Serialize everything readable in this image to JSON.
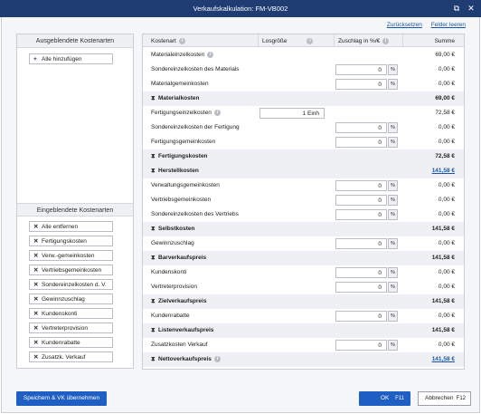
{
  "window": {
    "title": "Verkaufskalkulation: FM-VB002"
  },
  "top_links": {
    "reset": "Zurücksetzen",
    "clear": "Felder leeren"
  },
  "hidden_costs": {
    "title": "Ausgeblendete Kostenarten",
    "add_all": "Alle hinzufügen"
  },
  "shown_costs": {
    "title": "Eingeblendete Kostenarten",
    "items": [
      "Alle entfernen",
      "Fertigungskosten",
      "Verw.-gemeinkosten",
      "Vertriebsgemeinkosten",
      "Sondereinzelkosten d. V.",
      "Gewinnzuschlag",
      "Kundenskonti",
      "Vertreterprovision",
      "Kundenrabatte",
      "Zusatzk. Verkauf"
    ]
  },
  "table": {
    "headers": {
      "kostenart": "Kostenart",
      "losgroesse": "Losgröße",
      "zuschlag": "Zuschlag in %/€",
      "summe": "Summe"
    },
    "rows": [
      {
        "label": "Materialeinzelkosten",
        "sum": "69,00 €",
        "info": true
      },
      {
        "label": "Sondereinzelkosten des Materials",
        "input": "0",
        "unit": "%",
        "sum": "0,00 €"
      },
      {
        "label": "Materialgemeinkosten",
        "input": "0",
        "unit": "%",
        "sum": "0,00 €"
      },
      {
        "label": "Materialkosten",
        "sum": "69,00 €",
        "subtotal": true
      },
      {
        "label": "Fertigungseinzelkosten",
        "lot": "1 Einh",
        "sum": "72,58 €",
        "info": true
      },
      {
        "label": "Sondereinzelkosten der Fertigung",
        "input": "0",
        "unit": "%",
        "sum": "0,00 €"
      },
      {
        "label": "Fertigungsgemeinkosten",
        "input": "0",
        "unit": "%",
        "sum": "0,00 €"
      },
      {
        "label": "Fertigungskosten",
        "sum": "72,58 €",
        "subtotal": true
      },
      {
        "label": "Herstellkosten",
        "sum": "141,58 €",
        "subtotal": true,
        "link": true
      },
      {
        "label": "Verwaltungsgemeinkosten",
        "input": "0",
        "unit": "%",
        "sum": "0,00 €"
      },
      {
        "label": "Vertriebsgemeinkosten",
        "input": "0",
        "unit": "%",
        "sum": "0,00 €"
      },
      {
        "label": "Sondereinzelkosten des Vertriebs",
        "input": "0",
        "unit": "%",
        "sum": "0,00 €"
      },
      {
        "label": "Selbstkosten",
        "sum": "141,58 €",
        "subtotal": true
      },
      {
        "label": "Gewinnzuschlag",
        "input": "0",
        "unit": "%",
        "sum": "0,00 €"
      },
      {
        "label": "Barverkaufspreis",
        "sum": "141,58 €",
        "subtotal": true
      },
      {
        "label": "Kundenskonti",
        "input": "0",
        "unit": "%",
        "sum": "0,00 €"
      },
      {
        "label": "Vertreterprovision",
        "input": "0",
        "unit": "%",
        "sum": "0,00 €"
      },
      {
        "label": "Zielverkaufspreis",
        "sum": "141,58 €",
        "subtotal": true
      },
      {
        "label": "Kundenrabatte",
        "input": "0",
        "unit": "%",
        "sum": "0,00 €"
      },
      {
        "label": "Listenverkaufspreis",
        "sum": "141,58 €",
        "subtotal": true
      },
      {
        "label": "Zusatzkosten Verkauf",
        "input": "0",
        "unit": "%",
        "sum": "0,00 €"
      },
      {
        "label": "Nettoverkaufspreis",
        "sum": "141,58 €",
        "subtotal": true,
        "link": true,
        "info": true
      }
    ]
  },
  "footer": {
    "save_vk": "Speichern & VK übernehmen",
    "ok": "OK",
    "ok_key": "F11",
    "cancel": "Abbrechen",
    "cancel_key": "F12"
  }
}
